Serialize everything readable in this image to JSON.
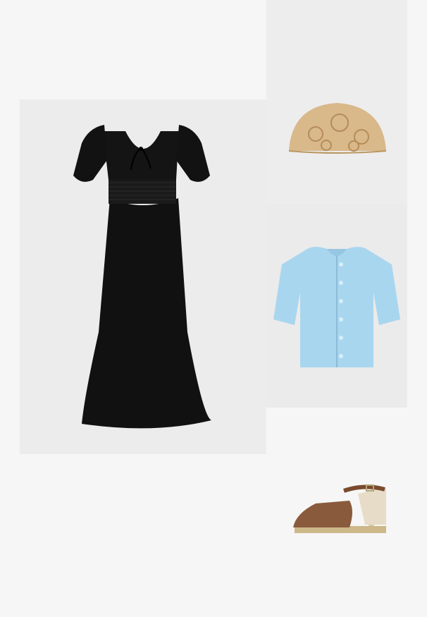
{
  "outfit": {
    "items": [
      {
        "name": "black-dress",
        "color": "#151515"
      },
      {
        "name": "straw-clutch",
        "color": "#d9b88a"
      },
      {
        "name": "blue-cardigan",
        "color": "#a9d6ef"
      },
      {
        "name": "espadrille-wedge",
        "color": "#8a5a3d"
      }
    ]
  }
}
